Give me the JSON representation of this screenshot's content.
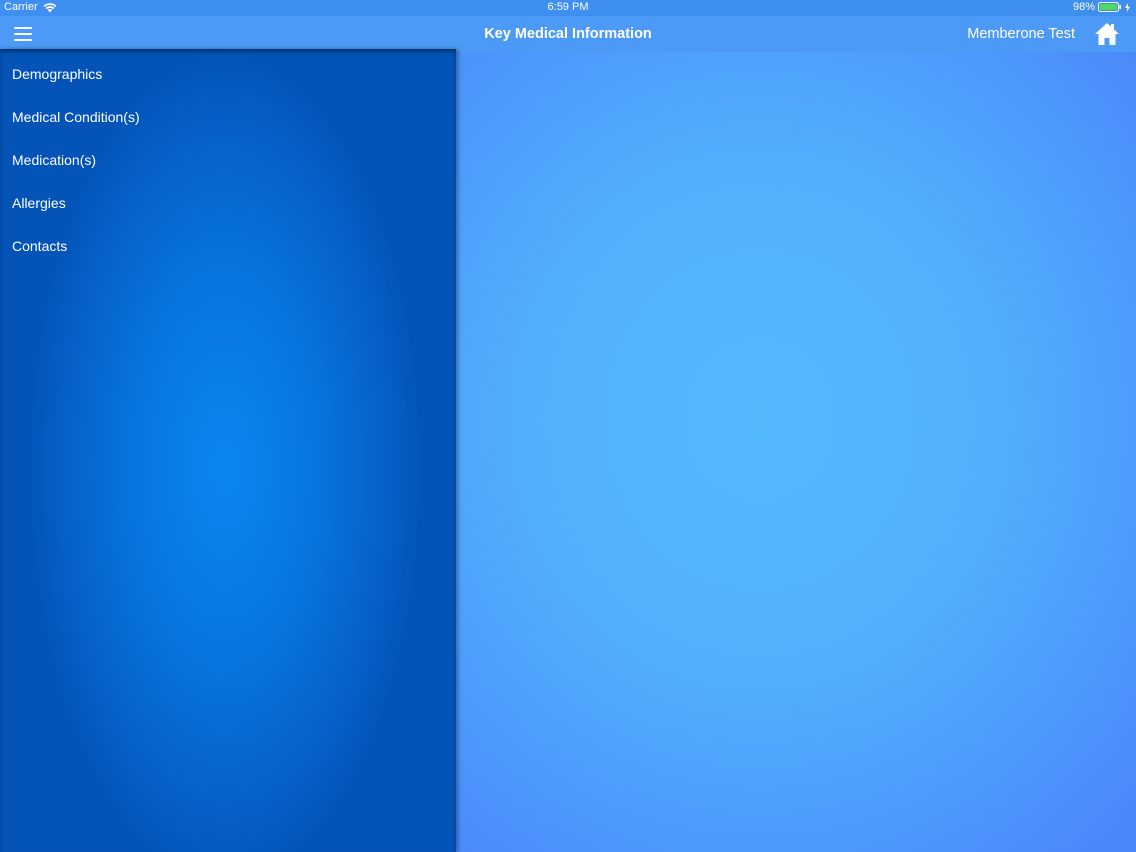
{
  "status_bar": {
    "carrier": "Carrier",
    "time": "6:59 PM",
    "battery": "98%",
    "battery_color": "#4cd964"
  },
  "nav": {
    "menu_icon": "hamburger-menu-icon",
    "title": "Key Medical Information",
    "user_name": "Memberone Test",
    "home_icon": "home-icon"
  },
  "sidebar": {
    "items": [
      {
        "label": "Demographics"
      },
      {
        "label": "Medical Condition(s)"
      },
      {
        "label": "Medication(s)"
      },
      {
        "label": "Allergies"
      },
      {
        "label": "Contacts"
      }
    ]
  },
  "colors": {
    "nav_bar": "#4c9af5",
    "sidebar": "#0875e0",
    "content": "#51b0fd"
  }
}
